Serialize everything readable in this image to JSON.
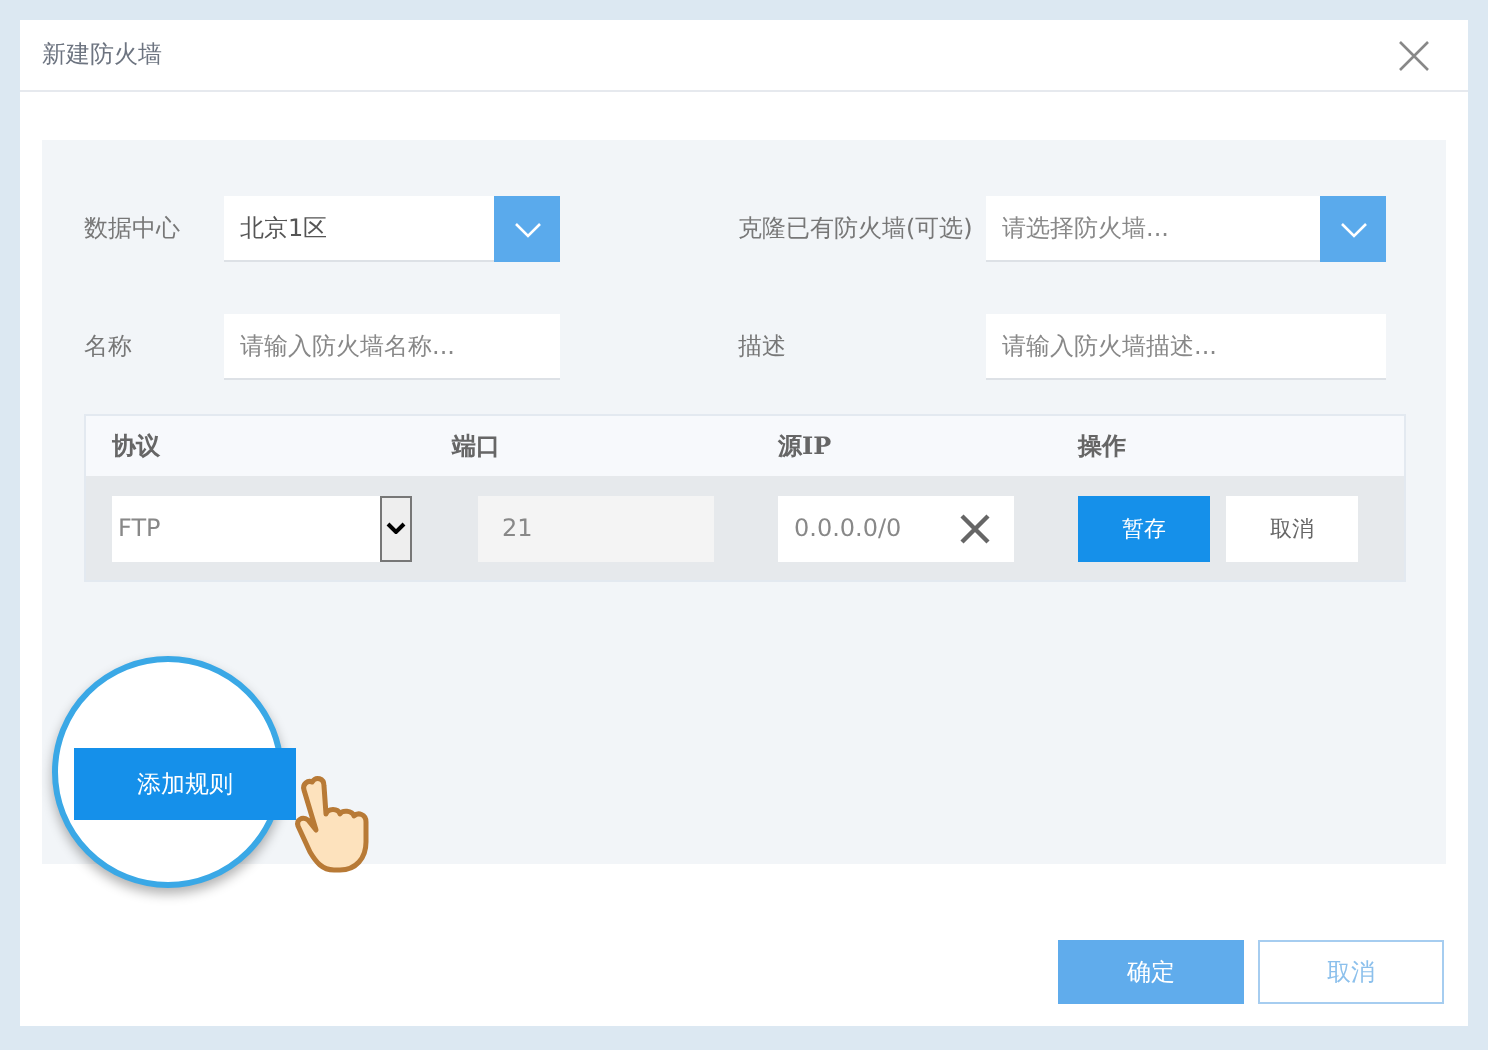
{
  "dialog": {
    "title": "新建防火墙"
  },
  "fields": [
    {
      "kind": "select",
      "label": "数据中心",
      "value": "北京1区"
    },
    {
      "kind": "select",
      "label": "克隆已有防火墙(可选)",
      "placeholder": "请选择防火墙..."
    },
    {
      "kind": "input",
      "label": "名称",
      "placeholder": "请输入防火墙名称..."
    },
    {
      "kind": "input",
      "label": "描述",
      "placeholder": "请输入防火墙描述..."
    }
  ],
  "rules_table": {
    "columns": [
      "协议",
      "端口",
      "源IP",
      "操作"
    ],
    "rows": [
      {
        "protocol": "FTP",
        "port": "21",
        "source_ip": "0.0.0.0/0",
        "save": "暂存",
        "cancel": "取消"
      }
    ]
  },
  "add_rule_button": "添加规则",
  "footer": {
    "buttons": [
      {
        "label": "确定",
        "kind": "primary"
      },
      {
        "label": "取消",
        "kind": "secondary"
      }
    ]
  }
}
